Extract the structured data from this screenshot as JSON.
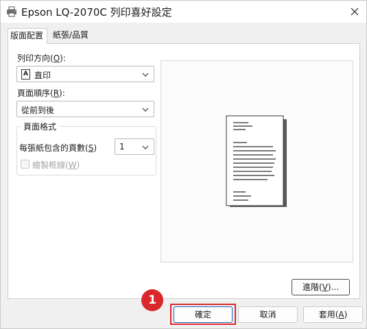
{
  "window": {
    "title": "Epson LQ-2070C 列印喜好設定"
  },
  "tabs": [
    {
      "label": "版面配置",
      "active": true
    },
    {
      "label": "紙張/品質",
      "active": false
    }
  ],
  "layout": {
    "orientation_label": "列印方向(O):",
    "orientation_value": "直印",
    "page_order_label": "頁面順序(R):",
    "page_order_value": "從前到後",
    "page_format_group": "頁面格式",
    "pages_per_sheet_label": "每張紙包含的頁數(S)",
    "pages_per_sheet_value": "1",
    "draw_borders_label": "繪製框線(W)",
    "advanced_button": "進階(V)..."
  },
  "footer": {
    "ok": "確定",
    "cancel": "取消",
    "apply": "套用(A)"
  },
  "annotation": {
    "step_number": "1",
    "highlight_color": "#d9272b"
  },
  "icons": {
    "title": "printer-icon",
    "close": "close-icon",
    "orientation": "portrait-icon",
    "dropdown": "chevron-down-icon"
  }
}
